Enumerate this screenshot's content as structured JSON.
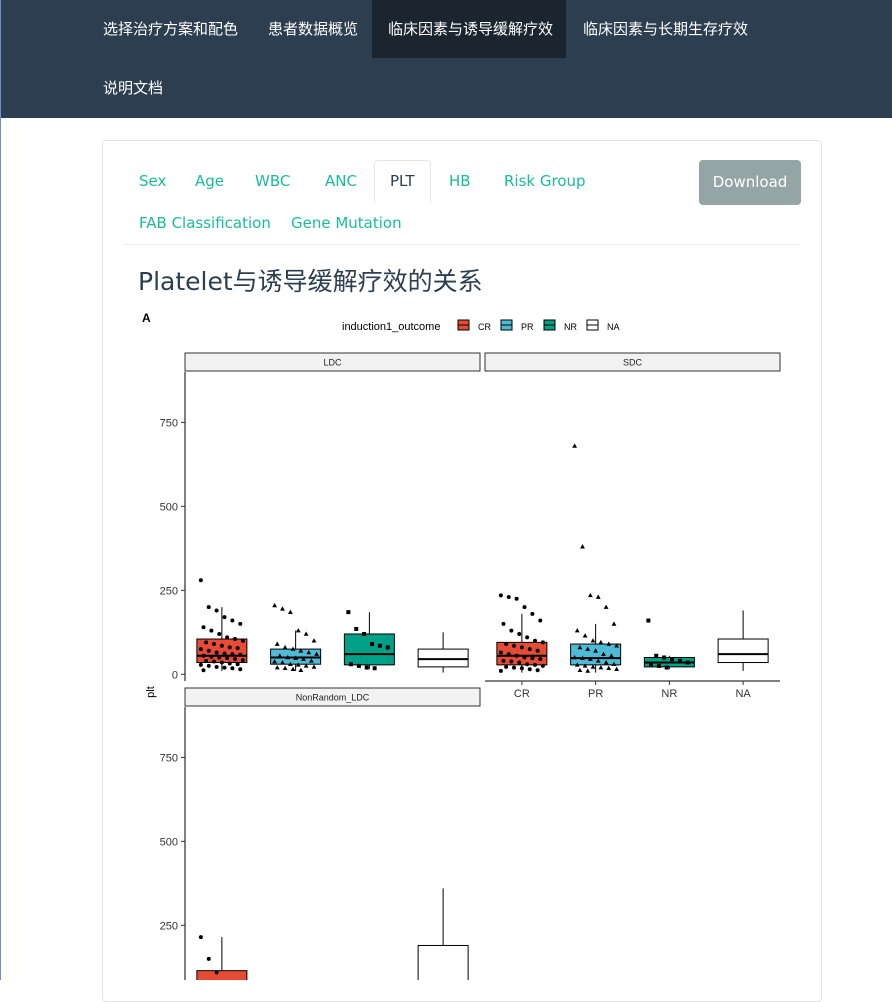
{
  "nav": {
    "items": [
      "选择治疗方案和配色",
      "患者数据概览",
      "临床因素与诱导缓解疗效",
      "临床因素与长期生存疗效"
    ],
    "docs": "说明文档",
    "active": "临床因素与诱导缓解疗效"
  },
  "tabs": {
    "row1": [
      "Sex",
      "Age",
      "WBC",
      "ANC",
      "PLT",
      "HB",
      "Risk Group"
    ],
    "row2": [
      "FAB Classification",
      "Gene Mutation"
    ],
    "active": "PLT"
  },
  "download_label": "Download",
  "heading": "Platelet与诱导缓解疗效的关系",
  "colors": {
    "nav_bg": "#2c3e50",
    "nav_active": "#1a252f",
    "tab_link": "#18bc9c",
    "button": "#95a5a6",
    "CR": "#e64b35",
    "PR": "#4dbbd5",
    "NR": "#00a087",
    "NA": "#ffffff"
  },
  "chart_data": {
    "type": "box",
    "panel_label": "A",
    "legend_title": "induction1_outcome",
    "legend_position": "top",
    "legend_items": [
      "CR",
      "PR",
      "NR",
      "NA"
    ],
    "categories": [
      "CR",
      "PR",
      "NR",
      "NA"
    ],
    "ylabel": "plt",
    "y_ticks": [
      0,
      250,
      500,
      750
    ],
    "ylim": [
      -20,
      900
    ],
    "facets": [
      {
        "name": "LDC",
        "boxes": [
          {
            "group": "CR",
            "q1": 35,
            "median": 55,
            "q3": 105,
            "low": 10,
            "high": 200
          },
          {
            "group": "PR",
            "q1": 30,
            "median": 50,
            "q3": 75,
            "low": 10,
            "high": 130
          },
          {
            "group": "NR",
            "q1": 28,
            "median": 60,
            "q3": 120,
            "low": 15,
            "high": 185
          },
          {
            "group": "NA",
            "q1": 22,
            "median": 45,
            "q3": 75,
            "low": 5,
            "high": 125
          }
        ],
        "points": [
          {
            "group": "CR",
            "values": [
              280,
              200,
              190,
              170,
              160,
              150,
              140,
              130,
              120,
              110,
              105,
              100,
              95,
              90,
              85,
              80,
              78,
              75,
              70,
              65,
              62,
              60,
              58,
              55,
              52,
              50,
              48,
              45,
              42,
              40,
              38,
              35,
              32,
              30,
              28,
              25,
              22,
              20,
              18,
              15,
              12
            ]
          },
          {
            "group": "PR",
            "values": [
              205,
              195,
              185,
              130,
              120,
              100,
              90,
              80,
              75,
              70,
              65,
              60,
              55,
              50,
              48,
              45,
              40,
              38,
              35,
              30,
              28,
              25,
              22,
              20,
              18,
              15,
              12
            ]
          },
          {
            "group": "NR",
            "values": [
              185,
              135,
              120,
              90,
              85,
              80,
              30,
              25,
              20,
              18
            ]
          }
        ]
      },
      {
        "name": "SDC",
        "boxes": [
          {
            "group": "CR",
            "q1": 28,
            "median": 55,
            "q3": 95,
            "low": 5,
            "high": 180
          },
          {
            "group": "PR",
            "q1": 28,
            "median": 48,
            "q3": 90,
            "low": 5,
            "high": 150
          },
          {
            "group": "NR",
            "q1": 22,
            "median": 35,
            "q3": 50,
            "low": 15,
            "high": 55
          },
          {
            "group": "NA",
            "q1": 35,
            "median": 60,
            "q3": 105,
            "low": 10,
            "high": 190
          }
        ],
        "points": [
          {
            "group": "CR",
            "values": [
              235,
              230,
              225,
              200,
              180,
              160,
              150,
              130,
              120,
              110,
              100,
              95,
              90,
              85,
              80,
              75,
              70,
              65,
              60,
              55,
              50,
              48,
              45,
              40,
              38,
              35,
              30,
              28,
              25,
              22,
              20,
              18,
              15,
              12,
              10
            ]
          },
          {
            "group": "PR",
            "values": [
              680,
              380,
              235,
              230,
              200,
              150,
              130,
              115,
              100,
              95,
              90,
              85,
              80,
              75,
              70,
              60,
              55,
              50,
              48,
              45,
              40,
              35,
              30,
              28,
              25,
              22,
              20,
              18,
              15,
              12,
              10
            ]
          },
          {
            "group": "NR",
            "values": [
              160,
              55,
              50,
              45,
              40,
              35,
              30,
              25,
              20
            ]
          }
        ]
      },
      {
        "name": "NonRandom_LDC",
        "boxes": [
          {
            "group": "CR",
            "q1": null,
            "median": null,
            "q3": 115,
            "low": null,
            "high": 215
          },
          {
            "group": "NA",
            "q1": null,
            "median": null,
            "q3": 190,
            "low": null,
            "high": 360
          }
        ],
        "points": [
          {
            "group": "CR",
            "values": [
              215,
              150,
              110
            ]
          }
        ]
      }
    ]
  }
}
